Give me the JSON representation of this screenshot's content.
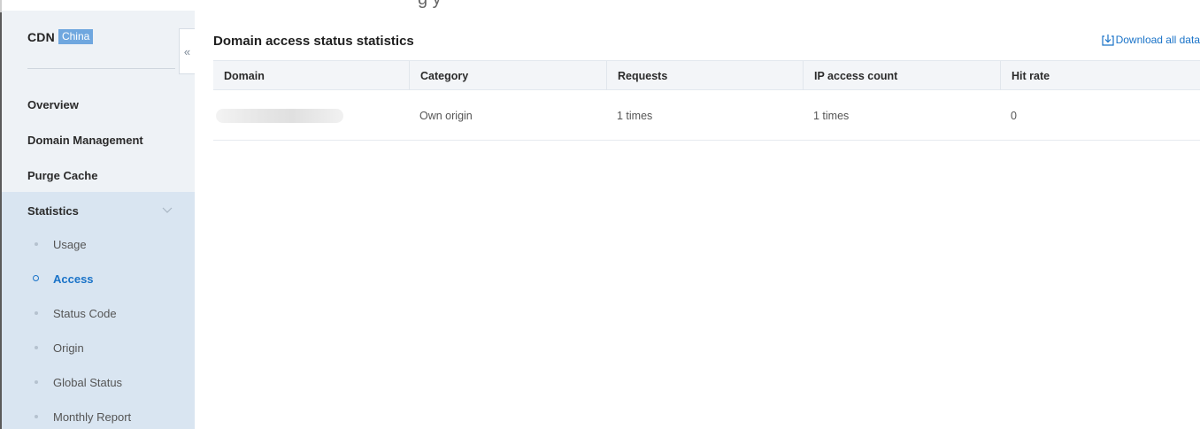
{
  "header_cut_text": "g          y",
  "sidebar": {
    "brand": "CDN",
    "region_badge": "China",
    "collapse_glyph": "«",
    "nav": {
      "overview": "Overview",
      "domain_management": "Domain Management",
      "purge_cache": "Purge Cache",
      "statistics": "Statistics"
    },
    "statistics_items": [
      {
        "label": "Usage",
        "active": false
      },
      {
        "label": "Access",
        "active": true
      },
      {
        "label": "Status Code",
        "active": false
      },
      {
        "label": "Origin",
        "active": false
      },
      {
        "label": "Global Status",
        "active": false
      },
      {
        "label": "Monthly Report",
        "active": false
      }
    ]
  },
  "main": {
    "title": "Domain access status statistics",
    "download_label": "Download all data",
    "table": {
      "columns": [
        "Domain",
        "Category",
        "Requests",
        "IP access count",
        "Hit rate"
      ],
      "rows": [
        {
          "domain": "",
          "category": "Own origin",
          "requests": "1 times",
          "ip_access_count": "1 times",
          "hit_rate": "0"
        }
      ]
    }
  },
  "colors": {
    "sidebar_bg": "#eef2f6",
    "statistics_group_bg": "#d9e5f1",
    "accent": "#1a73c8",
    "badge_bg": "#6fa7df"
  },
  "icons": [
    "collapse-icon",
    "chevron-down-icon",
    "download-icon",
    "bullet-icon",
    "active-circle-icon"
  ]
}
